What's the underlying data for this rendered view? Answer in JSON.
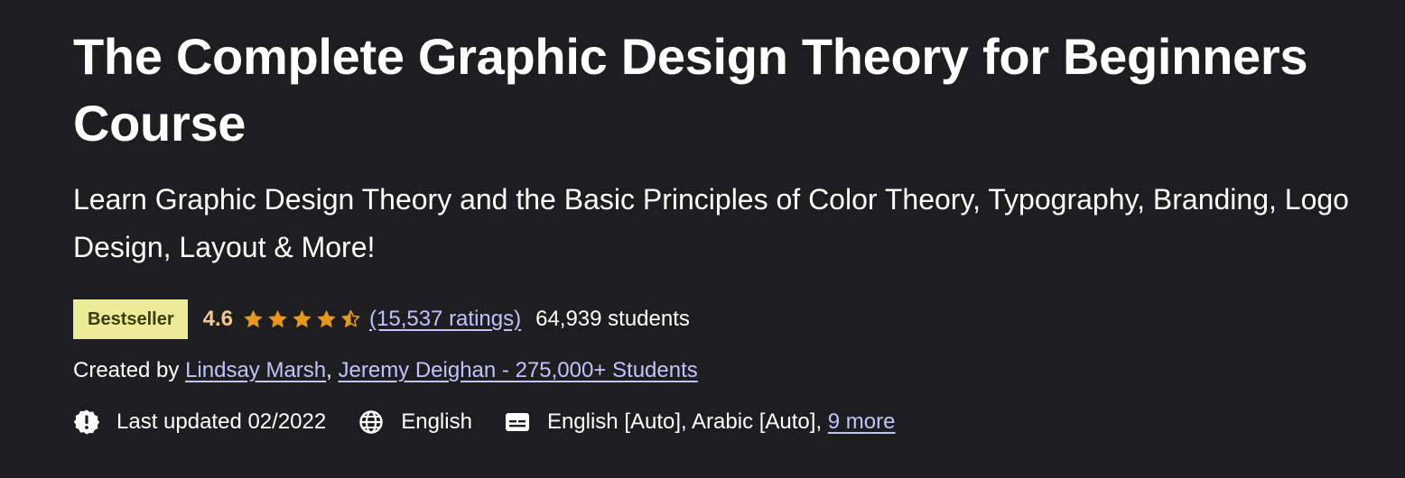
{
  "course": {
    "title": "The Complete Graphic Design Theory for Beginners Course",
    "subtitle": "Learn Graphic Design Theory and the Basic Principles of Color Theory, Typography, Branding, Logo Design, Layout & More!",
    "badge": "Bestseller",
    "rating": "4.6",
    "rating_value": 4.6,
    "rating_max": 5,
    "ratings_link": "(15,537 ratings)",
    "students": "64,939 students",
    "created_prefix": "Created by",
    "instructors": [
      "Lindsay Marsh",
      "Jeremy Deighan - 275,000+ Students"
    ],
    "instructor_separator": ", ",
    "last_updated": "Last updated 02/2022",
    "language": "English",
    "captions": "English [Auto], Arabic [Auto],",
    "captions_more": "9 more"
  },
  "icons": {
    "star": "star-icon",
    "half_star": "half-star-icon",
    "last_updated": "alert-badge-icon",
    "language": "globe-icon",
    "captions": "closed-captions-icon"
  },
  "colors": {
    "background": "#1e1d20",
    "text": "#ffffff",
    "badge_bg": "#eceb98",
    "badge_text": "#3d3c0a",
    "rating": "#f3ca8c",
    "stars": "#e59819",
    "link": "#c0c4fc"
  }
}
